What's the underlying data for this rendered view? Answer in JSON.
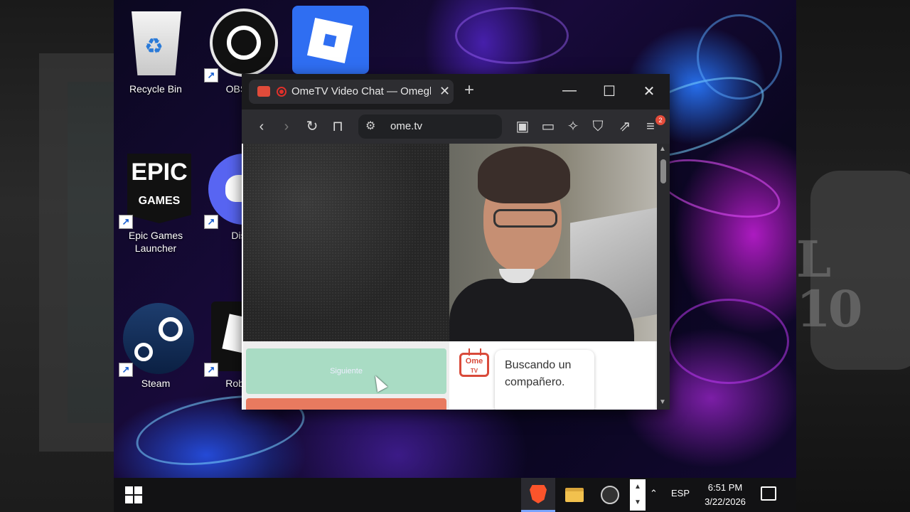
{
  "desktop": {
    "icons": [
      {
        "label": "Recycle Bin"
      },
      {
        "label": "OBS S"
      },
      {
        "label": ""
      },
      {
        "label": "Epic Games Launcher"
      },
      {
        "label": "Disc"
      },
      {
        "label": "Steam"
      },
      {
        "label": "Roblox"
      }
    ],
    "epic_logo_line1": "EPIC",
    "epic_logo_line2": "GAMES"
  },
  "browser": {
    "tab_title": "OmeTV Video Chat — Omegl",
    "tab_close": "✕",
    "new_tab": "+",
    "window_controls": {
      "minimize": "—",
      "maximize": "☐",
      "close": "✕"
    },
    "url": "ome.tv",
    "toolbar_icons": [
      "back-icon",
      "forward-icon",
      "reload-icon",
      "bookmark-icon",
      "sidebar-icon",
      "wallet-icon",
      "leo-ai-icon",
      "shield-icon",
      "vpn-icon",
      "menu-icon"
    ],
    "menu_badge": "2"
  },
  "page": {
    "next_button": "Siguiente",
    "ome_logo_line1": "Ome",
    "ome_logo_line2": "TV",
    "status_message": "Buscando un compañero."
  },
  "taskbar": {
    "language": "ESP",
    "time": "6:51 PM",
    "date": "3/22/2026",
    "pinned_apps": [
      "brave-icon",
      "file-explorer-icon",
      "obs-icon"
    ]
  },
  "colors": {
    "next_button": "#a9dcc4",
    "stop_button": "#e87a5f",
    "ome_brand": "#d94a3a",
    "taskbar": "#121214"
  }
}
